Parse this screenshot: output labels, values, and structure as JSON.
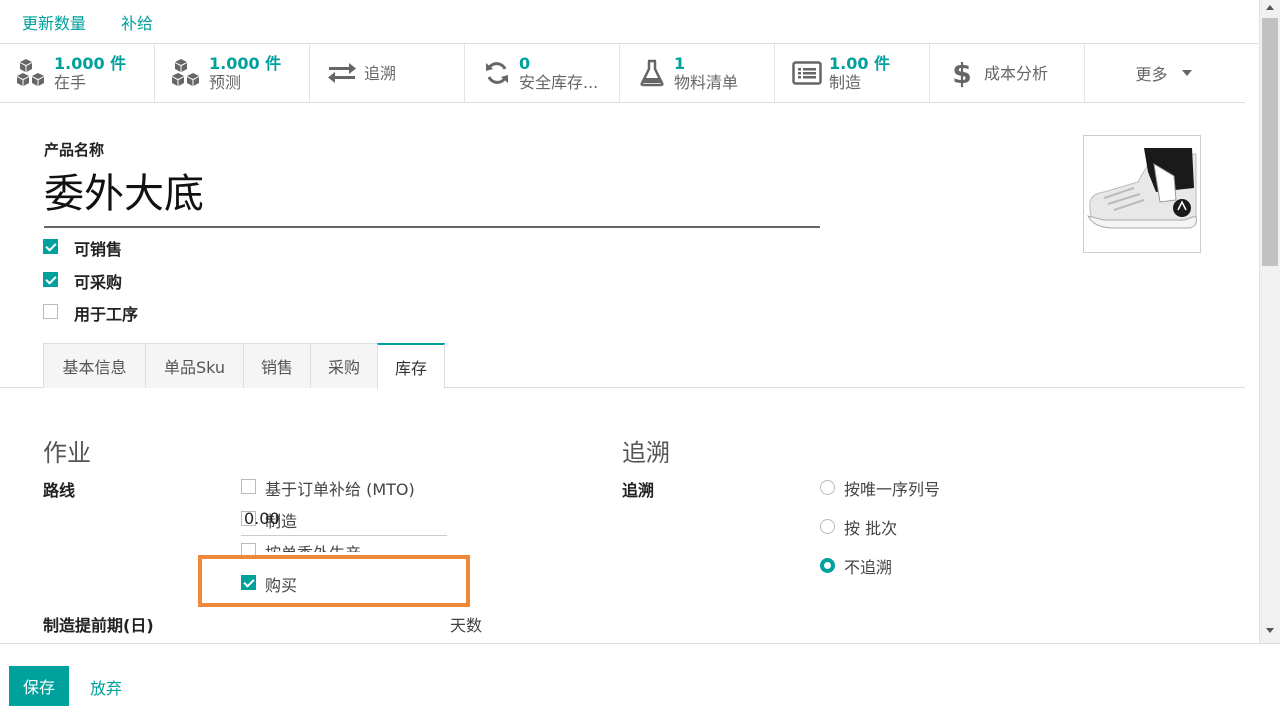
{
  "topbar": {
    "update_qty": "更新数量",
    "replenish": "补给"
  },
  "stats": [
    {
      "icon": "cubes-icon",
      "num": "1.000 件",
      "label": "在手"
    },
    {
      "icon": "cubes-icon",
      "num": "1.000 件",
      "label": "预测"
    },
    {
      "icon": "exchange-icon",
      "label": "追溯"
    },
    {
      "icon": "refresh-icon",
      "num": "0",
      "label": "安全库存..."
    },
    {
      "icon": "flask-icon",
      "num": "1",
      "label": "物料清单"
    },
    {
      "icon": "list-icon",
      "num": "1.00 件",
      "label": "制造"
    },
    {
      "icon": "dollar-icon",
      "label": "成本分析"
    },
    {
      "label": "更多"
    }
  ],
  "form": {
    "name_label": "产品名称",
    "name_value": "委外大底",
    "flags": [
      {
        "label": "可销售",
        "checked": true
      },
      {
        "label": "可采购",
        "checked": true
      },
      {
        "label": "用于工序",
        "checked": false
      }
    ]
  },
  "tabs": [
    "基本信息",
    "单品Sku",
    "销售",
    "采购",
    "库存"
  ],
  "inventory": {
    "ops_title": "作业",
    "route_label": "路线",
    "routes": [
      {
        "label": "基于订单补给 (MTO)",
        "checked": false
      },
      {
        "label": "制造",
        "checked": false
      },
      {
        "label": "按单委外生产",
        "checked": false
      },
      {
        "label": "购买",
        "checked": true
      }
    ],
    "lead_label": "制造提前期(日)",
    "lead_value": "0.00",
    "lead_unit": "天数",
    "trace_title": "追溯",
    "trace_label": "追溯",
    "trace_options": [
      {
        "label": "按唯一序列号",
        "selected": false
      },
      {
        "label": "按 批次",
        "selected": false
      },
      {
        "label": "不追溯",
        "selected": true
      }
    ]
  },
  "footer": {
    "save": "保存",
    "discard": "放弃"
  },
  "colors": {
    "accent": "#00a09d",
    "highlight": "#f0883a"
  }
}
